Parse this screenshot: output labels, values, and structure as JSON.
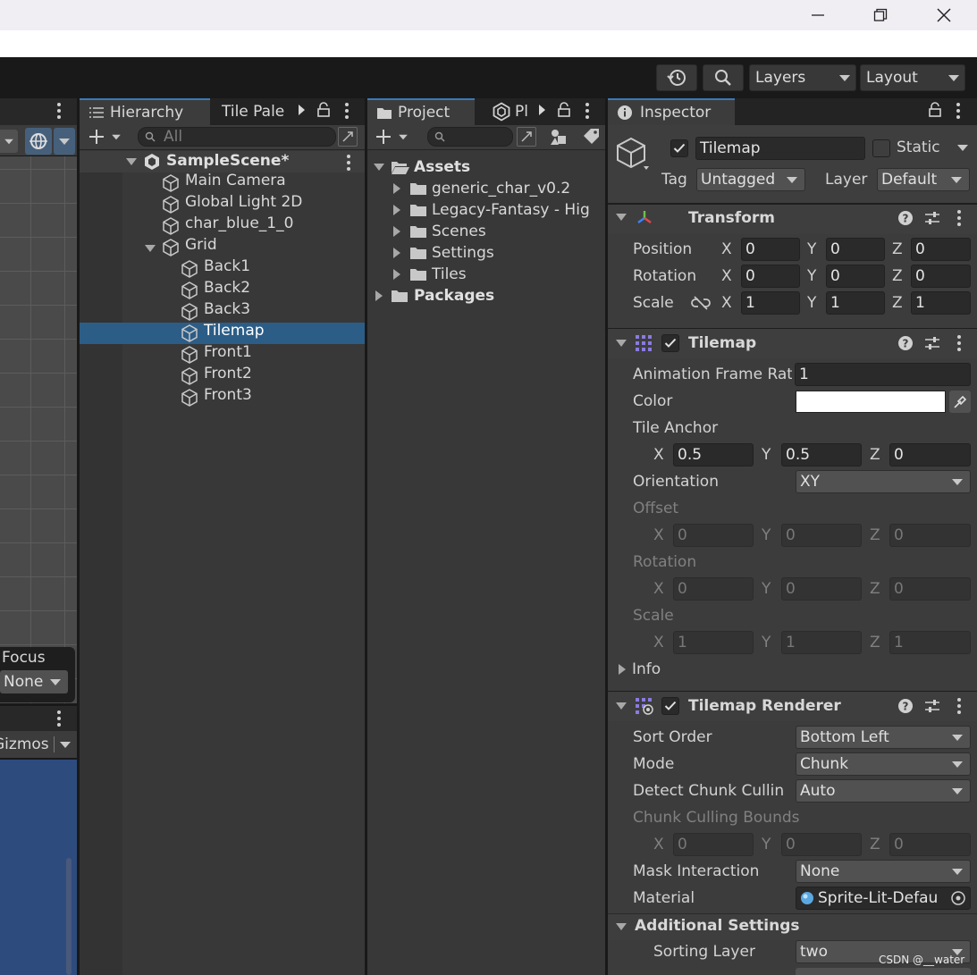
{
  "window": {
    "minimize_icon": "minimize-icon",
    "maximize_icon": "restore-icon",
    "close_icon": "close-icon"
  },
  "toolbar": {
    "layers_label": "Layers",
    "layout_label": "Layout"
  },
  "scene": {
    "focus_label": "Focus",
    "none_label": "None",
    "gizmos_label": "Gizmos"
  },
  "hierarchy": {
    "tab_label": "Hierarchy",
    "tab2_label": "Tile Pale",
    "search_placeholder": "All",
    "scene_name": "SampleScene*",
    "items": [
      {
        "label": "Main Camera"
      },
      {
        "label": "Global Light 2D"
      },
      {
        "label": "char_blue_1_0"
      },
      {
        "label": "Grid"
      },
      {
        "label": "Back1"
      },
      {
        "label": "Back2"
      },
      {
        "label": "Back3"
      },
      {
        "label": "Tilemap"
      },
      {
        "label": "Front1"
      },
      {
        "label": "Front2"
      },
      {
        "label": "Front3"
      }
    ]
  },
  "project": {
    "tab_label": "Project",
    "tab2_label": "Pl",
    "root": "Assets",
    "folders": [
      {
        "label": "generic_char_v0.2"
      },
      {
        "label": "Legacy-Fantasy - Hig"
      },
      {
        "label": "Scenes"
      },
      {
        "label": "Settings"
      },
      {
        "label": "Tiles"
      }
    ],
    "packages": "Packages"
  },
  "inspector": {
    "tab_label": "Inspector",
    "object_name": "Tilemap",
    "static_label": "Static",
    "tag_label": "Tag",
    "tag_value": "Untagged",
    "layer_label": "Layer",
    "layer_value": "Default",
    "transform": {
      "title": "Transform",
      "position_label": "Position",
      "rotation_label": "Rotation",
      "scale_label": "Scale",
      "x": "X",
      "y": "Y",
      "z": "Z",
      "position": [
        "0",
        "0",
        "0"
      ],
      "rotation": [
        "0",
        "0",
        "0"
      ],
      "scale": [
        "1",
        "1",
        "1"
      ]
    },
    "tilemap": {
      "title": "Tilemap",
      "anim_rate_label": "Animation Frame Rat",
      "anim_rate": "1",
      "color_label": "Color",
      "color_value": "#ffffff",
      "tile_anchor_label": "Tile Anchor",
      "tile_anchor": [
        "0.5",
        "0.5",
        "0"
      ],
      "orientation_label": "Orientation",
      "orientation": "XY",
      "offset_label": "Offset",
      "offset": [
        "0",
        "0",
        "0"
      ],
      "rotation_label": "Rotation",
      "rotation": [
        "0",
        "0",
        "0"
      ],
      "scale_label": "Scale",
      "scale": [
        "1",
        "1",
        "1"
      ],
      "info_label": "Info"
    },
    "renderer": {
      "title": "Tilemap Renderer",
      "sort_order_label": "Sort Order",
      "sort_order": "Bottom Left",
      "mode_label": "Mode",
      "mode": "Chunk",
      "detect_label": "Detect Chunk Cullin",
      "detect": "Auto",
      "bounds_label": "Chunk Culling Bounds",
      "bounds": [
        "0",
        "0",
        "0"
      ],
      "mask_label": "Mask Interaction",
      "mask": "None",
      "material_label": "Material",
      "material": "Sprite-Lit-Defau"
    },
    "additional": {
      "title": "Additional Settings",
      "sorting_layer_label": "Sorting Layer",
      "sorting_layer": "two"
    }
  },
  "watermark": "CSDN @__water",
  "colors": {
    "accent": "#3a79bb",
    "selection": "#2c5d87",
    "scene_blue": "#2e4b7e"
  }
}
